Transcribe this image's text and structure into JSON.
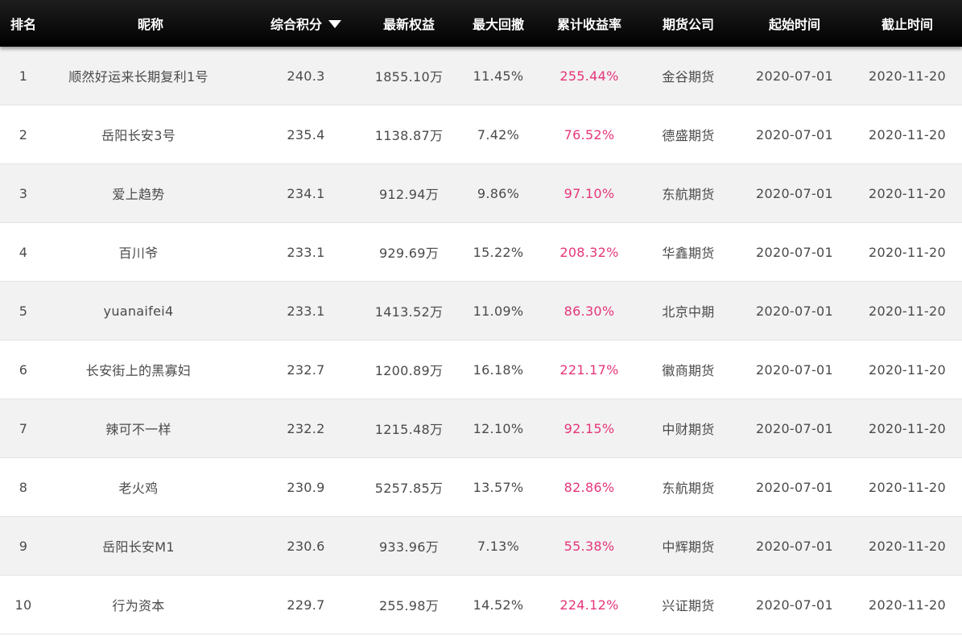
{
  "header": {
    "rank": "排名",
    "nickname": "昵称",
    "score": "综合积分",
    "equity": "最新权益",
    "max_drawdown": "最大回撤",
    "cum_return": "累计收益率",
    "company": "期货公司",
    "start_date": "起始时间",
    "end_date": "截止时间"
  },
  "colors": {
    "header_bg": "#000000",
    "header_text": "#ffffff",
    "row_alt_bg": "#f2f2f2",
    "row_bg": "#ffffff",
    "text": "#4a4a4a",
    "return_accent": "#e5357a"
  },
  "rows": [
    {
      "rank": "1",
      "nickname": "顺然好运来长期复利1号",
      "score": "240.3",
      "equity": "1855.10万",
      "max_drawdown": "11.45%",
      "cum_return": "255.44%",
      "company": "金谷期货",
      "start_date": "2020-07-01",
      "end_date": "2020-11-20"
    },
    {
      "rank": "2",
      "nickname": "岳阳长安3号",
      "score": "235.4",
      "equity": "1138.87万",
      "max_drawdown": "7.42%",
      "cum_return": "76.52%",
      "company": "德盛期货",
      "start_date": "2020-07-01",
      "end_date": "2020-11-20"
    },
    {
      "rank": "3",
      "nickname": "爱上趋势",
      "score": "234.1",
      "equity": "912.94万",
      "max_drawdown": "9.86%",
      "cum_return": "97.10%",
      "company": "东航期货",
      "start_date": "2020-07-01",
      "end_date": "2020-11-20"
    },
    {
      "rank": "4",
      "nickname": "百川爷",
      "score": "233.1",
      "equity": "929.69万",
      "max_drawdown": "15.22%",
      "cum_return": "208.32%",
      "company": "华鑫期货",
      "start_date": "2020-07-01",
      "end_date": "2020-11-20"
    },
    {
      "rank": "5",
      "nickname": "yuanaifei4",
      "score": "233.1",
      "equity": "1413.52万",
      "max_drawdown": "11.09%",
      "cum_return": "86.30%",
      "company": "北京中期",
      "start_date": "2020-07-01",
      "end_date": "2020-11-20"
    },
    {
      "rank": "6",
      "nickname": "长安街上的黑寡妇",
      "score": "232.7",
      "equity": "1200.89万",
      "max_drawdown": "16.18%",
      "cum_return": "221.17%",
      "company": "徽商期货",
      "start_date": "2020-07-01",
      "end_date": "2020-11-20"
    },
    {
      "rank": "7",
      "nickname": "辣可不一样",
      "score": "232.2",
      "equity": "1215.48万",
      "max_drawdown": "12.10%",
      "cum_return": "92.15%",
      "company": "中财期货",
      "start_date": "2020-07-01",
      "end_date": "2020-11-20"
    },
    {
      "rank": "8",
      "nickname": "老火鸡",
      "score": "230.9",
      "equity": "5257.85万",
      "max_drawdown": "13.57%",
      "cum_return": "82.86%",
      "company": "东航期货",
      "start_date": "2020-07-01",
      "end_date": "2020-11-20"
    },
    {
      "rank": "9",
      "nickname": "岳阳长安M1",
      "score": "230.6",
      "equity": "933.96万",
      "max_drawdown": "7.13%",
      "cum_return": "55.38%",
      "company": "中辉期货",
      "start_date": "2020-07-01",
      "end_date": "2020-11-20"
    },
    {
      "rank": "10",
      "nickname": "行为资本",
      "score": "229.7",
      "equity": "255.98万",
      "max_drawdown": "14.52%",
      "cum_return": "224.12%",
      "company": "兴证期货",
      "start_date": "2020-07-01",
      "end_date": "2020-11-20"
    }
  ]
}
